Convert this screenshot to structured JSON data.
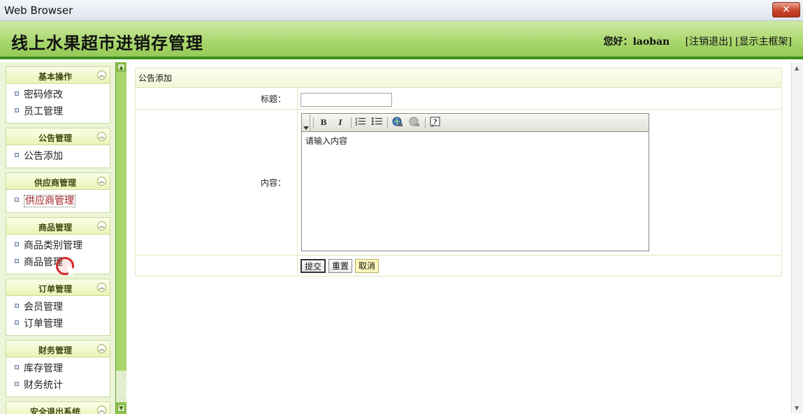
{
  "window": {
    "title": "Web Browser",
    "close_glyph": "✕"
  },
  "header": {
    "title": "线上水果超市进销存管理",
    "greeting": "您好：",
    "username": "laoban",
    "logout_link": "[注销退出]",
    "show_frame_link": "[显示主框架]",
    "accent_color": "#3e8d1b"
  },
  "sidebar": {
    "groups": [
      {
        "title": "基本操作",
        "items": [
          "密码修改",
          "员工管理"
        ]
      },
      {
        "title": "公告管理",
        "items": [
          "公告添加"
        ]
      },
      {
        "title": "供应商管理",
        "items": [
          "供应商管理"
        ]
      },
      {
        "title": "商品管理",
        "items": [
          "商品类别管理",
          "商品管理"
        ]
      },
      {
        "title": "订单管理",
        "items": [
          "会员管理",
          "订单管理"
        ]
      },
      {
        "title": "财务管理",
        "items": [
          "库存管理",
          "财务统计"
        ]
      },
      {
        "title": "安全退出系统",
        "items": []
      }
    ],
    "collapse_glyph": "︽",
    "active_item": "供应商管理"
  },
  "form": {
    "caption": "公告添加",
    "title_label": "标题：",
    "title_value": "",
    "content_label": "内容：",
    "editor_placeholder": "请输入内容",
    "toolbar": {
      "bold": "B",
      "italic": "I",
      "ordered_list_icon": "ordered-list-icon",
      "unordered_list_icon": "unordered-list-icon",
      "link_icon": "link-icon",
      "unlink_icon": "unlink-icon",
      "help_icon": "help-icon"
    },
    "buttons": {
      "submit": "提交",
      "reset": "重置",
      "cancel": "取消"
    }
  }
}
